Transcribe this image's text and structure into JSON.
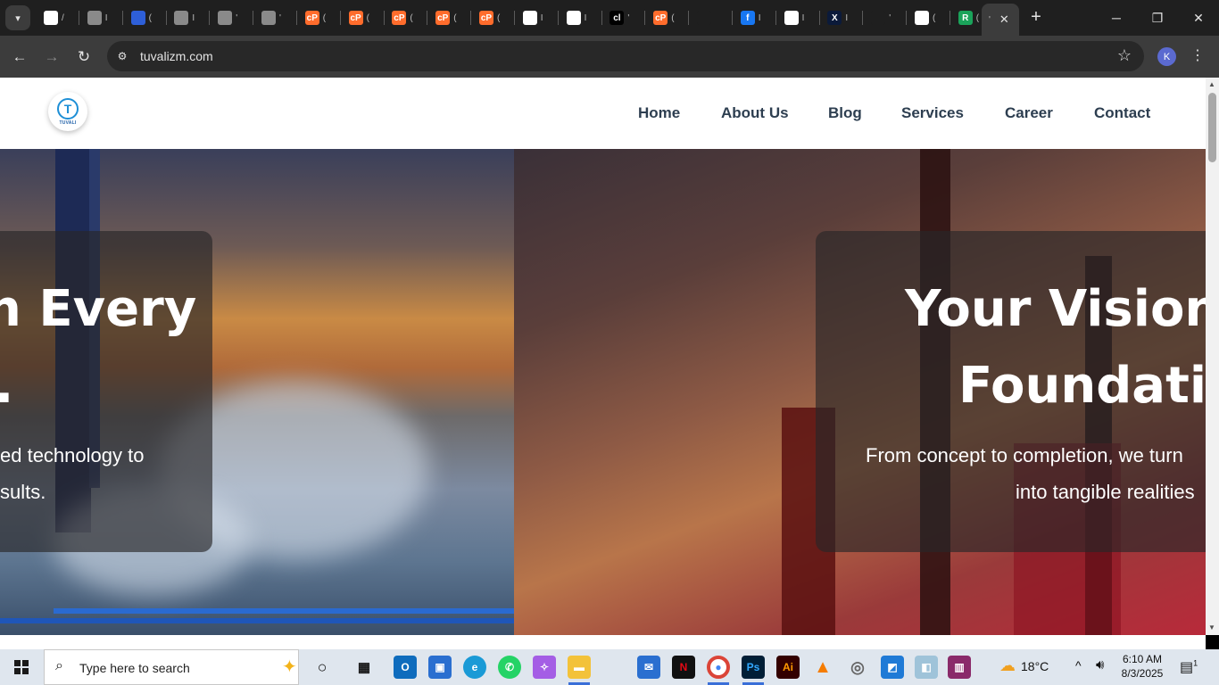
{
  "browser": {
    "tabs": [
      {
        "icon": "site-favicon-icon",
        "fav_text": "",
        "fav_color": "#ffffff",
        "frag": "/"
      },
      {
        "icon": "globe-icon",
        "fav_text": "",
        "fav_color": "#8a8a8a",
        "frag": "I"
      },
      {
        "icon": "site-favicon-icon",
        "fav_text": "",
        "fav_color": "#2e5fd8",
        "frag": "("
      },
      {
        "icon": "globe-icon",
        "fav_text": "",
        "fav_color": "#8a8a8a",
        "frag": "I"
      },
      {
        "icon": "globe-icon",
        "fav_text": "",
        "fav_color": "#8a8a8a",
        "frag": "'"
      },
      {
        "icon": "globe-icon",
        "fav_text": "",
        "fav_color": "#8a8a8a",
        "frag": "'"
      },
      {
        "icon": "cpanel-icon",
        "fav_text": "cP",
        "fav_color": "#ff6c2c",
        "frag": "("
      },
      {
        "icon": "cpanel-icon",
        "fav_text": "cP",
        "fav_color": "#ff6c2c",
        "frag": "("
      },
      {
        "icon": "cpanel-icon",
        "fav_text": "cP",
        "fav_color": "#ff6c2c",
        "frag": "("
      },
      {
        "icon": "cpanel-icon",
        "fav_text": "cP",
        "fav_color": "#ff6c2c",
        "frag": "("
      },
      {
        "icon": "cpanel-icon",
        "fav_text": "cP",
        "fav_color": "#ff6c2c",
        "frag": "("
      },
      {
        "icon": "site-favicon-icon",
        "fav_text": "",
        "fav_color": "#ffffff",
        "frag": "I"
      },
      {
        "icon": "site-favicon-icon",
        "fav_text": "",
        "fav_color": "#ffffff",
        "frag": "I"
      },
      {
        "icon": "cl-icon",
        "fav_text": "cl",
        "fav_color": "#000000",
        "frag": "'"
      },
      {
        "icon": "cpanel-icon",
        "fav_text": "cP",
        "fav_color": "#ff6c2c",
        "frag": "("
      },
      {
        "icon": "chatgpt-icon",
        "fav_text": "",
        "fav_color": "#1f1f1f",
        "frag": ""
      },
      {
        "icon": "facebook-icon",
        "fav_text": "f",
        "fav_color": "#1877f2",
        "frag": "I"
      },
      {
        "icon": "google-icon",
        "fav_text": "G",
        "fav_color": "#ffffff",
        "frag": "I"
      },
      {
        "icon": "x-icon",
        "fav_text": "X",
        "fav_color": "#0b1a3a",
        "frag": "I"
      },
      {
        "icon": "blank-icon",
        "fav_text": "",
        "fav_color": "#1f1f1f",
        "frag": "'"
      },
      {
        "icon": "google-icon",
        "fav_text": "G",
        "fav_color": "#ffffff",
        "frag": "("
      },
      {
        "icon": "site-favicon-icon",
        "fav_text": "R",
        "fav_color": "#1aa35a",
        "frag": "("
      }
    ],
    "active_tab": {
      "frag": "'"
    },
    "url": "tuvalizm.com",
    "profile_initial": "K"
  },
  "site": {
    "logo_letter": "T",
    "logo_word": "TUVALI",
    "nav": [
      "Home",
      "About Us",
      "Blog",
      "Services",
      "Career",
      "Contact"
    ]
  },
  "hero": {
    "left": {
      "title_line1": "n Every",
      "title_line2": ".",
      "sub_line1": "ed technology to",
      "sub_line2": "sults."
    },
    "right": {
      "title_line1": "Your Vision,",
      "title_line2": "Foundatio",
      "sub_line1": "From concept to completion, we turn",
      "sub_line2": "into tangible realities"
    }
  },
  "taskbar": {
    "search_placeholder": "Type here to search",
    "weather_temp": "18°C",
    "time": "6:10 AM",
    "date": "8/3/2025",
    "notifications": "1"
  }
}
